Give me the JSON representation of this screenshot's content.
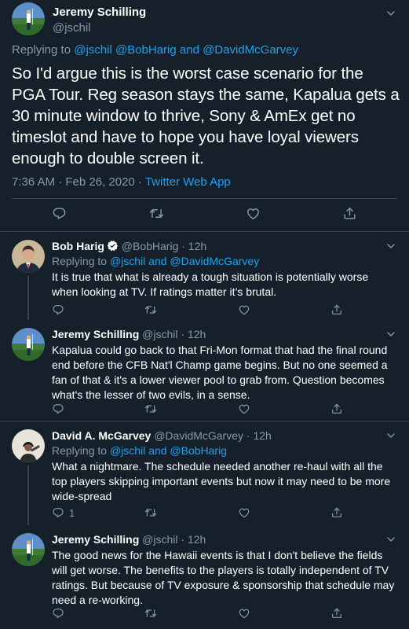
{
  "main_tweet": {
    "name": "Jeremy Schilling",
    "handle": "@jschil",
    "replying_label": "Replying to",
    "replying_to": "@jschil @BobHarig and @DavidMcGarvey",
    "text": "So I'd argue this is the worst case scenario for the PGA Tour. Reg season stays the same, Kapalua gets a 30 minute window to thrive, Sony & AmEx get no timeslot and have to hope you have loyal viewers enough to double screen it.",
    "timestamp": "7:36 AM · Feb 26, 2020 · ",
    "source": "Twitter Web App"
  },
  "replies": [
    {
      "name": "Bob Harig",
      "verified": true,
      "handle_time": "@BobHarig · 12h",
      "replying_label": "Replying to ",
      "replying_to": "@jschil and @DavidMcGarvey",
      "text": "It is true that what is already a tough situation is potentially worse when looking at TV. If ratings matter it’s brutal.",
      "reply_count": ""
    },
    {
      "name": "Jeremy Schilling",
      "verified": false,
      "handle_time": "@jschil · 12h",
      "text": "Kapalua could go back to that Fri-Mon format that had the final round end before the CFB Nat'l Champ game begins. But no one seemed a fan of that & it's a lower viewer pool to grab from. Question becomes what's the lesser of two evils, in a sense.",
      "reply_count": ""
    },
    {
      "name": "David A. McGarvey",
      "verified": false,
      "handle_time": "@DavidMcGarvey · 12h",
      "replying_label": "Replying to ",
      "replying_to": "@jschil and @BobHarig",
      "text": "What a nightmare. The schedule needed another re-haul with all the top players skipping important events but now it may need to be more wide-spread",
      "reply_count": "1"
    },
    {
      "name": "Jeremy Schilling",
      "verified": false,
      "handle_time": "@jschil · 12h",
      "text": "The good news for the Hawaii events is that I don't believe the fields will get worse. The benefits to the players is totally independent of TV ratings. But because of TV exposure & sponsorship that schedule may need a re-working.",
      "reply_count": ""
    }
  ],
  "colors": {
    "background": "#15202b",
    "accent": "#1da1f2",
    "secondary_text": "#8899a6",
    "divider": "#38444d"
  },
  "icons": [
    "chevron-down-icon",
    "reply-icon",
    "retweet-icon",
    "like-icon",
    "share-icon",
    "verified-badge-icon"
  ]
}
